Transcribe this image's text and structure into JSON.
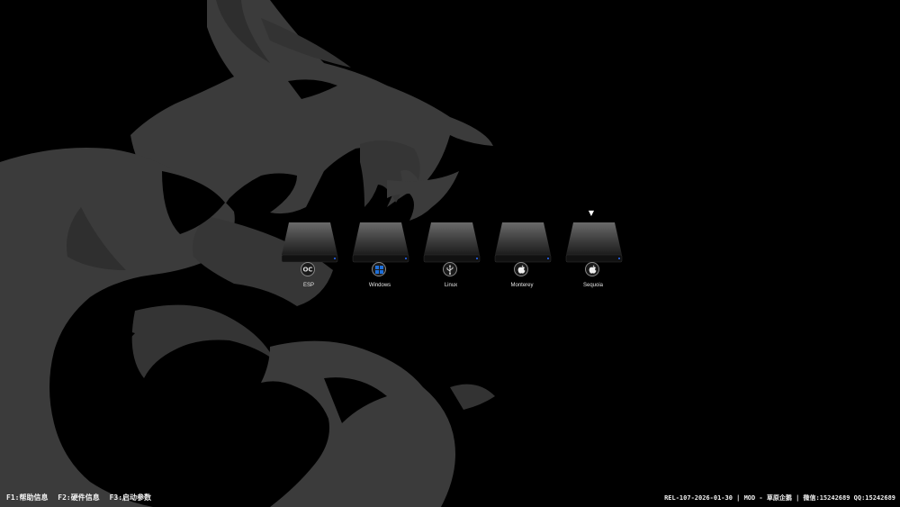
{
  "background": {
    "logo": "msi-dragon",
    "color": "#000000",
    "dragon_color": "#3a3a3a"
  },
  "boot_entries": [
    {
      "label": "ESP",
      "icon": "oc-icon",
      "selected": false
    },
    {
      "label": "Windows",
      "icon": "windows-icon",
      "selected": false
    },
    {
      "label": "Linux",
      "icon": "usb-icon",
      "selected": false
    },
    {
      "label": "Monterey",
      "icon": "apple-icon",
      "selected": false
    },
    {
      "label": "Sequoia",
      "icon": "apple-icon",
      "selected": true
    }
  ],
  "selector_glyph": "▼",
  "footer": {
    "hotkeys": [
      {
        "text": "F1:帮助信息"
      },
      {
        "text": "F2:硬件信息"
      },
      {
        "text": "F3:启动参数"
      }
    ],
    "info": "REL-107-2026-01-30 | MOD - 草原企鹅 | 微信:15242689 QQ:15242689"
  },
  "colors": {
    "indicator": "#2a6cff",
    "windows_blue": "#1e6fd9"
  }
}
